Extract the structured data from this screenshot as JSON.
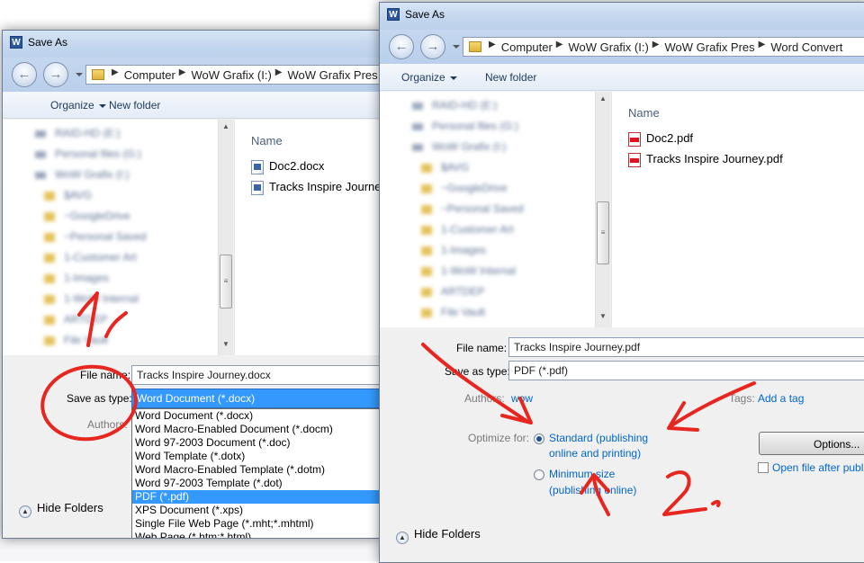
{
  "colors": {
    "accent": "#3399ff",
    "link": "#0066cc",
    "annotation": "#e6261f"
  },
  "icons": {
    "app": "word-icon",
    "back": "back-arrow-icon",
    "forward": "forward-arrow-icon",
    "folder": "folder-icon",
    "doc": "word-document-icon",
    "pdf": "pdf-document-icon"
  },
  "dialog1": {
    "title": "Save As",
    "app_icon_label": "W",
    "breadcrumb": [
      "Computer",
      "WoW Grafix (I:)",
      "WoW Grafix Pres"
    ],
    "toolbar": {
      "organize": "Organize",
      "new_folder": "New folder"
    },
    "file_list": {
      "column": "Name",
      "files": [
        "Doc2.docx",
        "Tracks Inspire Journey.docx"
      ]
    },
    "form": {
      "file_name_label": "File name:",
      "file_name_value": "Tracks Inspire Journey.docx",
      "save_type_label": "Save as type:",
      "save_type_value": "Word Document (*.docx)",
      "authors_label": "Authors:"
    },
    "type_options": [
      "Word Document (*.docx)",
      "Word Macro-Enabled Document (*.docm)",
      "Word 97-2003 Document (*.doc)",
      "Word Template (*.dotx)",
      "Word Macro-Enabled Template (*.dotm)",
      "Word 97-2003 Template (*.dot)",
      "PDF (*.pdf)",
      "XPS Document (*.xps)",
      "Single File Web Page (*.mht;*.mhtml)",
      "Web Page (*.htm;*.html)"
    ],
    "selected_option": "PDF (*.pdf)",
    "hide_folders": "Hide Folders",
    "annotation_number": "1."
  },
  "dialog2": {
    "title": "Save As",
    "app_icon_label": "W",
    "breadcrumb": [
      "Computer",
      "WoW Grafix (I:)",
      "WoW Grafix Pres",
      "Word Convert"
    ],
    "toolbar": {
      "organize": "Organize",
      "new_folder": "New folder"
    },
    "file_list": {
      "column": "Name",
      "files": [
        "Doc2.pdf",
        "Tracks Inspire Journey.pdf"
      ]
    },
    "form": {
      "file_name_label": "File name:",
      "file_name_value": "Tracks Inspire Journey.pdf",
      "save_type_label": "Save as type:",
      "save_type_value": "PDF (*.pdf)",
      "authors_label": "Authors:",
      "authors_value": "wow",
      "tags_label": "Tags:",
      "tags_value": "Add a tag",
      "optimize_label": "Optimize for:",
      "optimize_standard_line1": "Standard (publishing",
      "optimize_standard_line2": "online and printing)",
      "optimize_minimum_line1": "Minimum size",
      "optimize_minimum_line2": "(publishing online)",
      "options_button": "Options...",
      "open_after": "Open file after publishing"
    },
    "hide_folders": "Hide Folders",
    "annotation_number": "2."
  }
}
